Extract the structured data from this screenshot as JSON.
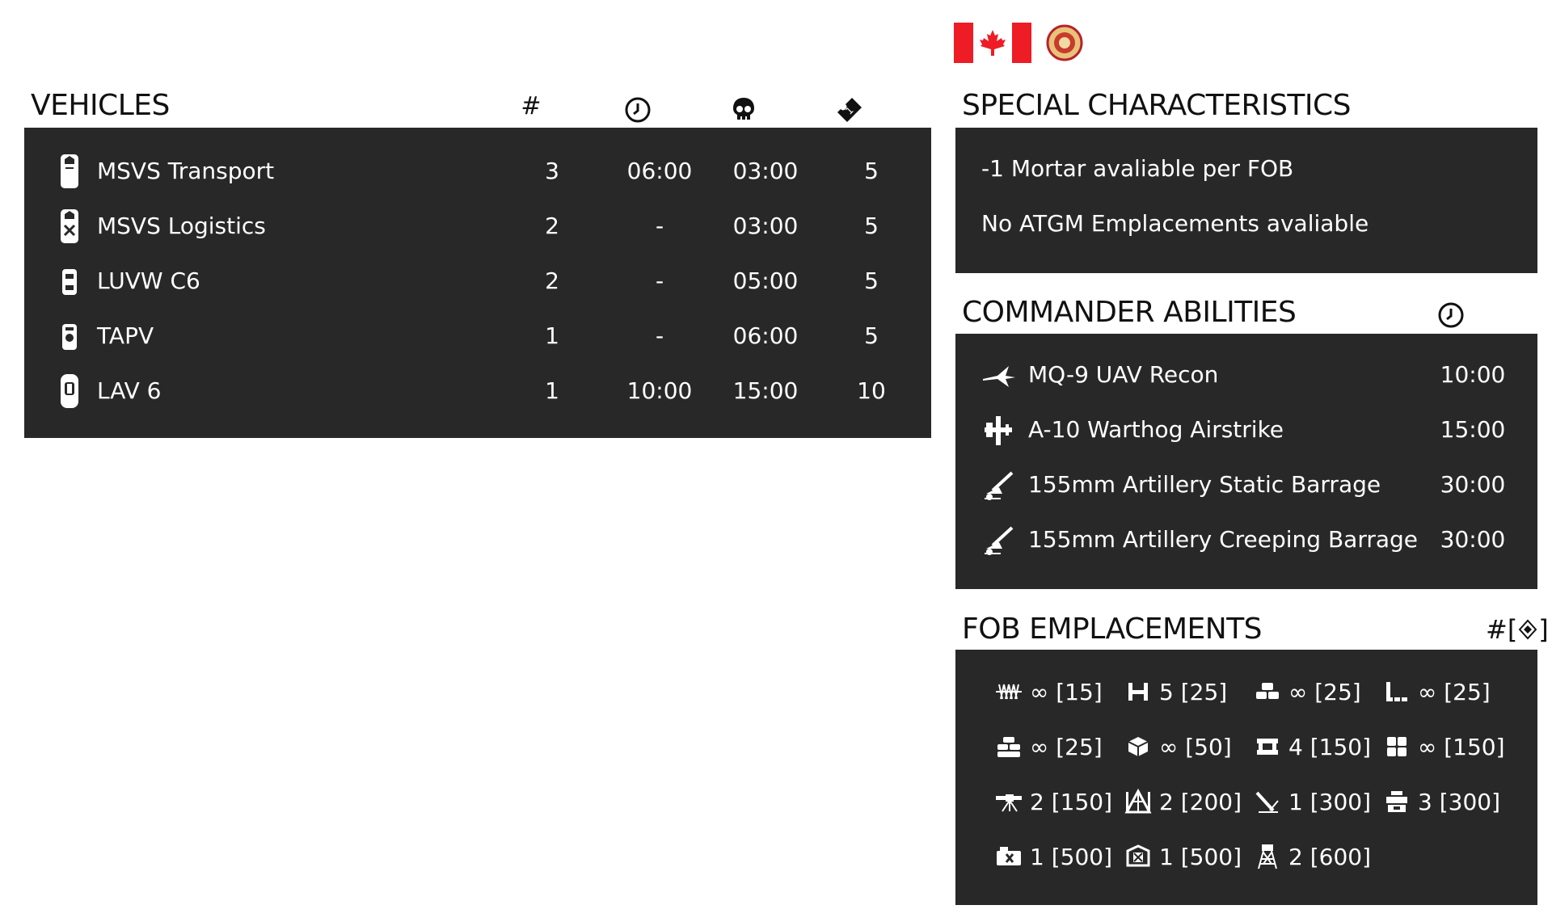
{
  "vehicles": {
    "title": "VEHICLES",
    "col_num": "#",
    "col_icons": [
      "clock-icon",
      "skull-icon",
      "ticket-icon"
    ],
    "rows": [
      {
        "icon": "msvs-transport-icon",
        "name": "MSVS Transport",
        "count": "3",
        "respawn": "06:00",
        "delay": "03:00",
        "tickets": "5"
      },
      {
        "icon": "msvs-logistics-icon",
        "name": "MSVS Logistics",
        "count": "2",
        "respawn": "-",
        "delay": "03:00",
        "tickets": "5"
      },
      {
        "icon": "luvw-icon",
        "name": "LUVW C6",
        "count": "2",
        "respawn": "-",
        "delay": "05:00",
        "tickets": "5"
      },
      {
        "icon": "tapv-icon",
        "name": "TAPV",
        "count": "1",
        "respawn": "-",
        "delay": "06:00",
        "tickets": "5"
      },
      {
        "icon": "lav-icon",
        "name": "LAV 6",
        "count": "1",
        "respawn": "10:00",
        "delay": "15:00",
        "tickets": "10"
      }
    ]
  },
  "special": {
    "title": "SPECIAL CHARACTERISTICS",
    "lines": [
      "-1 Mortar avaliable per FOB",
      "No ATGM Emplacements avaliable"
    ]
  },
  "commander": {
    "title": "COMMANDER ABILITIES",
    "rows": [
      {
        "icon": "uav-icon",
        "name": "MQ-9 UAV Recon",
        "time": "10:00"
      },
      {
        "icon": "airstrike-icon",
        "name": "A-10 Warthog Airstrike",
        "time": "15:00"
      },
      {
        "icon": "artillery-icon",
        "name": "155mm Artillery Static Barrage",
        "time": "30:00"
      },
      {
        "icon": "artillery-icon",
        "name": "155mm Artillery Creeping Barrage",
        "time": "30:00"
      }
    ]
  },
  "fob": {
    "title": "FOB EMPLACEMENTS",
    "key_label": "#[",
    "key_close": "]",
    "items": [
      {
        "icon": "razorwire-icon",
        "label": "∞ [15]"
      },
      {
        "icon": "barrier-icon",
        "label": "5 [25]"
      },
      {
        "icon": "sandbag-icon",
        "label": "∞ [25]"
      },
      {
        "icon": "corner-wall-icon",
        "label": "∞ [25]"
      },
      {
        "icon": "sandbag-wall-icon",
        "label": "∞ [25]"
      },
      {
        "icon": "hesco-icon",
        "label": "∞ [50]"
      },
      {
        "icon": "bunker-icon",
        "label": "4 [150]"
      },
      {
        "icon": "grid-wall-icon",
        "label": "∞ [150]"
      },
      {
        "icon": "machine-gun-icon",
        "label": "2 [150]"
      },
      {
        "icon": "tent-icon",
        "label": "2 [200]"
      },
      {
        "icon": "mortar-icon",
        "label": "1 [300]"
      },
      {
        "icon": "ammo-crate-icon",
        "label": "3 [300]"
      },
      {
        "icon": "repair-station-icon",
        "label": "1 [500]"
      },
      {
        "icon": "hab-icon",
        "label": "1 [500]"
      },
      {
        "icon": "tower-icon",
        "label": "2 [600]"
      }
    ]
  },
  "colors": {
    "panel_bg": "#282828",
    "text_light": "#ffffff",
    "text_dark": "#111111",
    "canada_red": "#ee1c25"
  }
}
